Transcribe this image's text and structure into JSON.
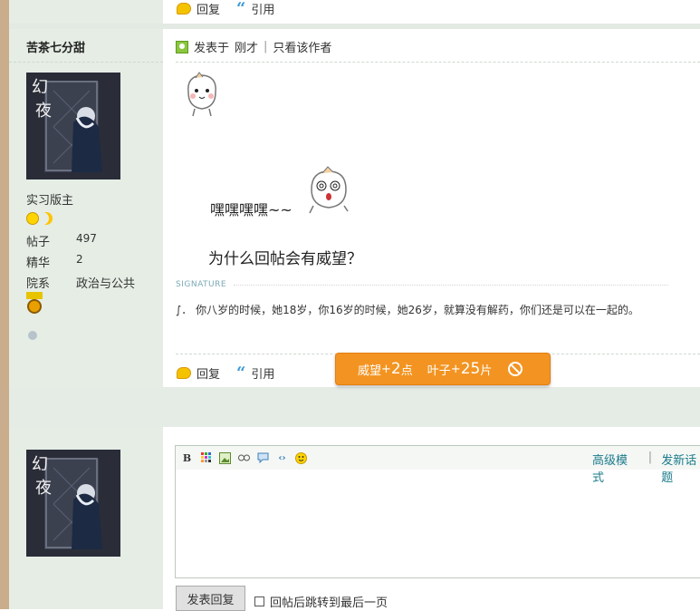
{
  "top_actions": {
    "reply_label": "回复",
    "quote_label": "引用"
  },
  "post": {
    "author": "苦茶七分甜",
    "meta": {
      "posted_label": "发表于",
      "time": "刚才",
      "author_only": "只看该作者"
    },
    "user": {
      "title": "实习版主",
      "stats": [
        {
          "label": "帖子",
          "value": "497"
        },
        {
          "label": "精华",
          "value": "2"
        },
        {
          "label": "院系",
          "value": "政治与公共"
        }
      ]
    },
    "content": {
      "line1": "嘿嘿嘿嘿~~",
      "line2": "为什么回帖会有威望？"
    },
    "signature": {
      "label": "SIGNATURE",
      "text": "∫． 你八岁的时候，她18岁，你16岁的时候，她26岁，就算没有解药，你们还是可以在一起的。"
    },
    "actions": {
      "reply_label": "回复",
      "quote_label": "引用"
    }
  },
  "reward": {
    "prestige_label": "威望",
    "prestige_plus": "+",
    "prestige_value": "2",
    "prestige_unit": "点",
    "leaves_label": "叶子",
    "leaves_plus": "+",
    "leaves_value": "25",
    "leaves_unit": "片"
  },
  "editor": {
    "advanced_mode": "高级模式",
    "new_topic": "发新话题",
    "submit_label": "发表回复",
    "jump_last_label": "回帖后跳转到最后一页"
  },
  "colors": {
    "accent": "#1a7b8a",
    "reward_bg": "#f39422",
    "sidebar": "#e5ede5"
  }
}
